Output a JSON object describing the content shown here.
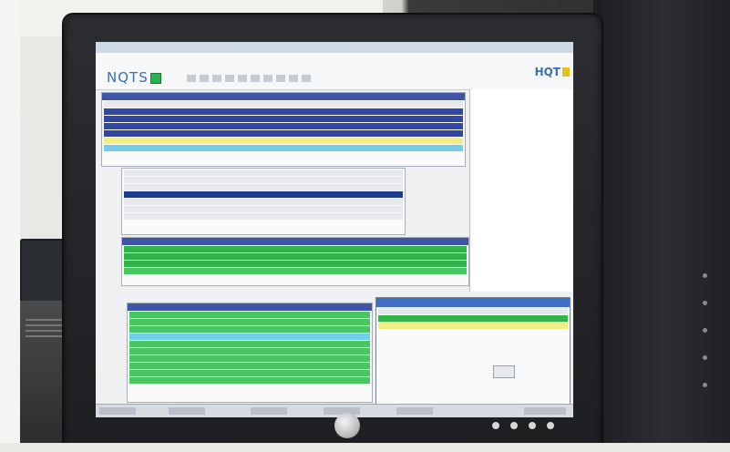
{
  "scene": {
    "description_elements": [
      "wall",
      "monitor",
      "server-tower",
      "network-equipment"
    ]
  },
  "app": {
    "logo_text": "NQTS",
    "brand_text": "HQT"
  },
  "colors": {
    "selection_blue": "#3147a3",
    "highlight_yellow": "#f1ee87",
    "highlight_cyan": "#72cde8",
    "status_green": "#30b449"
  }
}
